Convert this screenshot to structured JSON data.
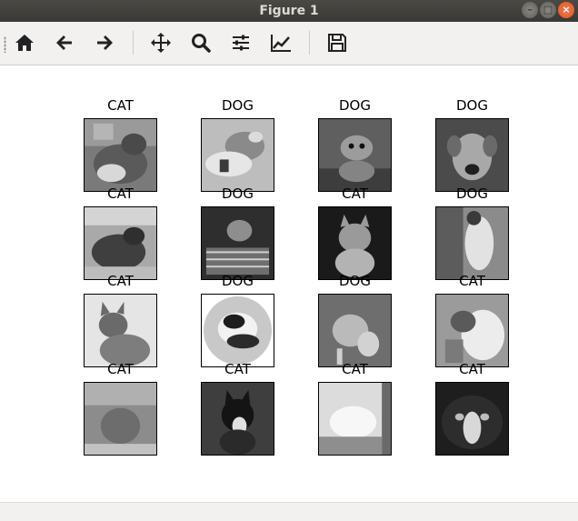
{
  "window": {
    "title": "Figure 1"
  },
  "toolbar": {
    "buttons": [
      "home-icon",
      "back-arrow-icon",
      "forward-arrow-icon",
      "pan-icon",
      "zoom-icon",
      "subplots-icon",
      "axes-edit-icon",
      "save-icon"
    ]
  },
  "grid": {
    "labels": [
      [
        "CAT",
        "DOG",
        "DOG",
        "DOG"
      ],
      [
        "CAT",
        "DOG",
        "CAT",
        "DOG"
      ],
      [
        "CAT",
        "DOG",
        "DOG",
        "CAT"
      ],
      [
        "CAT",
        "CAT",
        "CAT",
        "CAT"
      ]
    ]
  }
}
